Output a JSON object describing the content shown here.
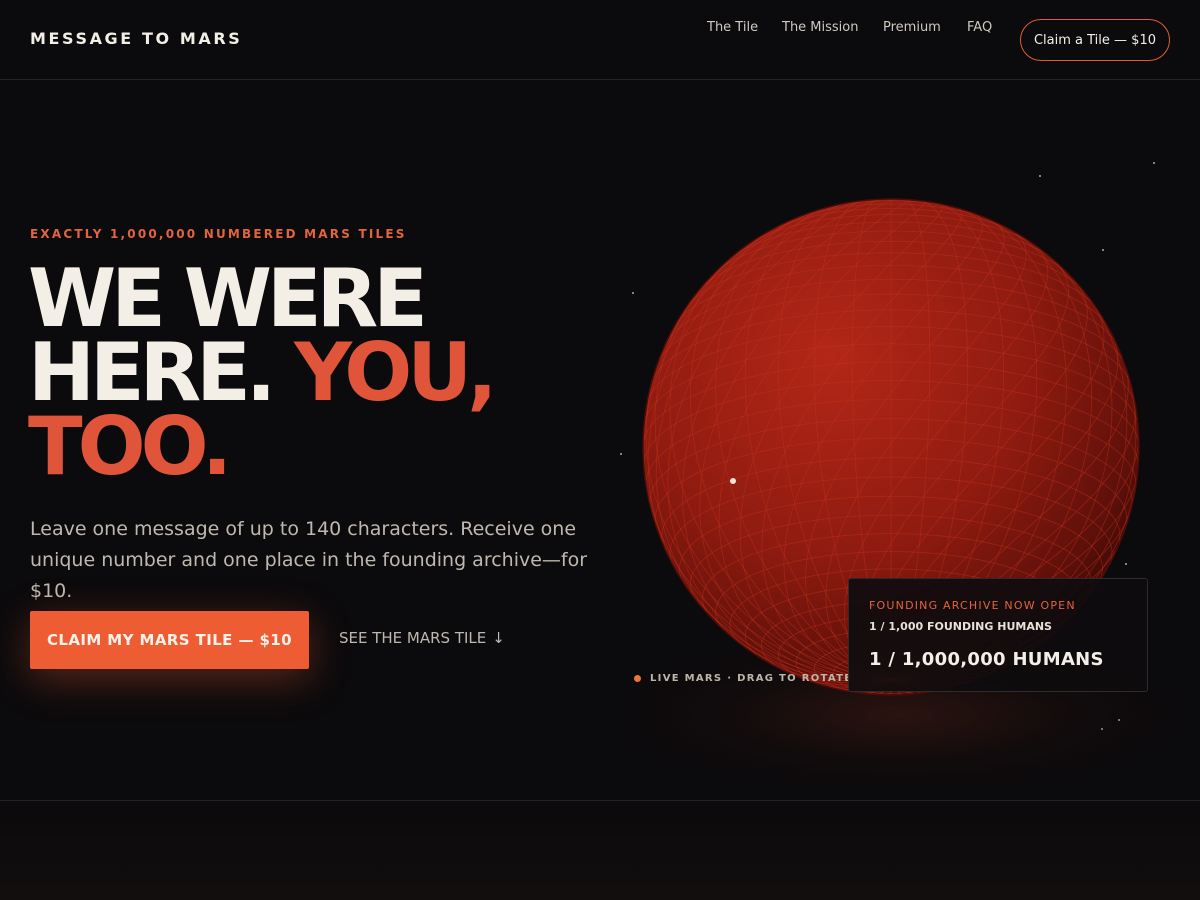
{
  "header": {
    "brand": "MESSAGE TO MARS",
    "nav": [
      "The Tile",
      "The Mission",
      "Premium",
      "FAQ"
    ],
    "cta_label": "Claim a Tile — $10"
  },
  "hero": {
    "eyebrow": "EXACTLY 1,000,000 NUMBERED MARS TILES",
    "headline_line1": "WE WERE",
    "headline_line2_a": "HERE.",
    "headline_line2_b": "YOU,",
    "headline_line3": "TOO.",
    "lede": "Leave one message of up to 140 characters. Receive one unique number and one place in the founding archive—for $10.",
    "primary_cta": "CLAIM MY MARS TILE — $10",
    "secondary_cta": "SEE THE MARS TILE",
    "secondary_cta_icon": "↓"
  },
  "planet": {
    "live_label": "LIVE MARS · DRAG TO ROTATE"
  },
  "card": {
    "eyebrow": "FOUNDING ARCHIVE NOW OPEN",
    "subtitle": "1 / 1,000 FOUNDING HUMANS",
    "main": "1 / 1,000,000 HUMANS"
  },
  "colors": {
    "accent": "#ee5c33",
    "headline_accent": "#e0543a",
    "planet": "#8e1a10",
    "background": "#0b0a0c"
  }
}
